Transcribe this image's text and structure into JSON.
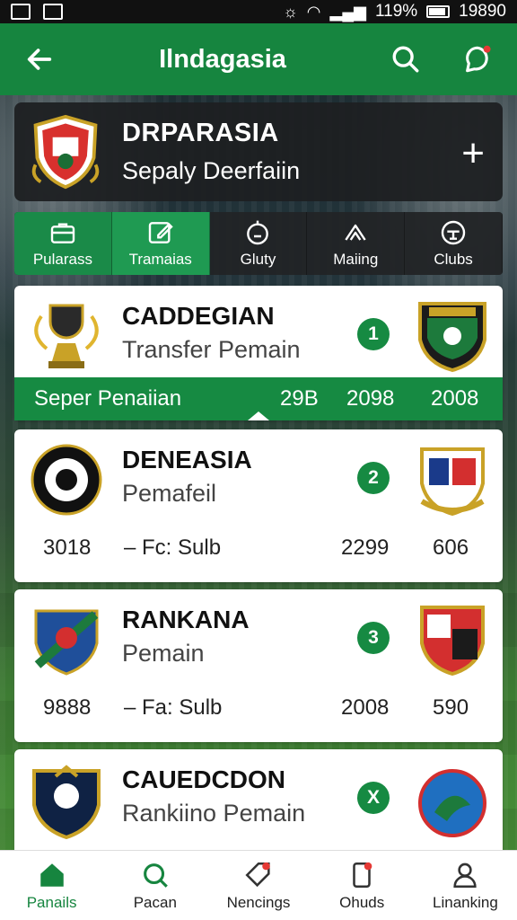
{
  "status_bar": {
    "battery": "119%",
    "time": "19890"
  },
  "app_bar": {
    "title": "Ilndagasia"
  },
  "club": {
    "name": "DRPARASIA",
    "subtitle": "Sepaly Deerfaiin"
  },
  "tabs": [
    {
      "label": "Pularass",
      "icon": "briefcase-icon"
    },
    {
      "label": "Tramaias",
      "icon": "edit-icon"
    },
    {
      "label": "Gluty",
      "icon": "timer-icon"
    },
    {
      "label": "Maiing",
      "icon": "chevron-up-icon"
    },
    {
      "label": "Clubs",
      "icon": "table-icon"
    }
  ],
  "rows": [
    {
      "name": "CADDEGIAN",
      "subtitle": "Transfer Pemain",
      "rank": "1",
      "strip": {
        "label": "Seper Penaiian",
        "v1": "29B",
        "v2": "2098",
        "v3": "2008"
      }
    },
    {
      "name": "DENEASIA",
      "subtitle": "Pemafeil",
      "rank": "2",
      "stats": {
        "a": "3018",
        "b": "– Fc: Sulb",
        "c": "2299",
        "d": "606"
      }
    },
    {
      "name": "RANKANA",
      "subtitle": "Pemain",
      "rank": "3",
      "stats": {
        "a": "9888",
        "b": "– Fa: Sulb",
        "c": "2008",
        "d": "590"
      }
    },
    {
      "name": "CAUEDCDON",
      "subtitle": "Rankiino Pemain",
      "rank": "X"
    }
  ],
  "bottom_nav": [
    {
      "label": "Panails",
      "icon": "home-icon"
    },
    {
      "label": "Pacan",
      "icon": "search-icon"
    },
    {
      "label": "Nencings",
      "icon": "tag-icon"
    },
    {
      "label": "Ohuds",
      "icon": "phone-icon"
    },
    {
      "label": "Linanking",
      "icon": "user-icon"
    }
  ],
  "colors": {
    "primary": "#16853f",
    "accent": "#168a42",
    "notification": "#e53935"
  }
}
